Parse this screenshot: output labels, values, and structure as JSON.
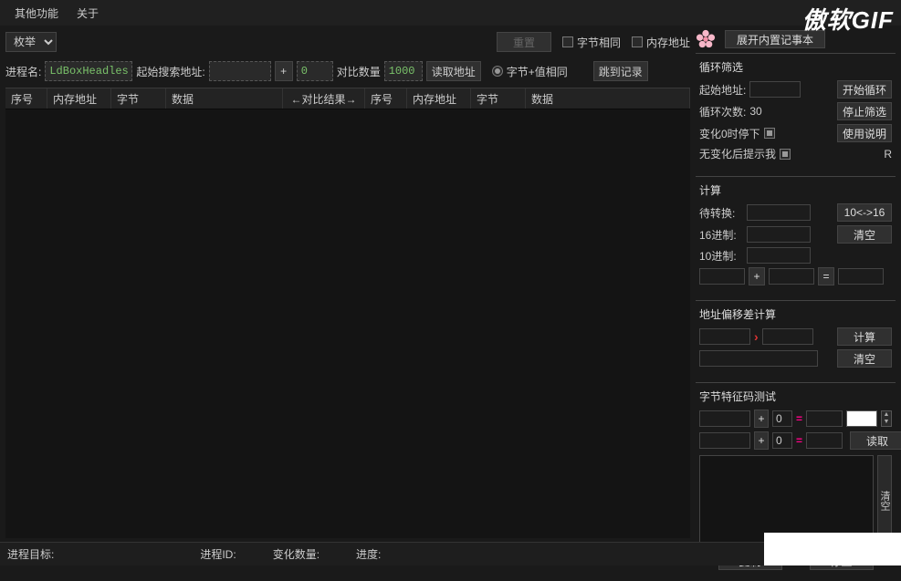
{
  "menu": {
    "other": "其他功能",
    "about": "关于"
  },
  "watermark": {
    "a": "傲软",
    "b": "GIF"
  },
  "toolbar1": {
    "enum_option": "枚举",
    "reset": "重置",
    "chk_byte_same": "字节相同",
    "chk_mem_addr": "内存地址",
    "expand_notepad": "展开内置记事本"
  },
  "toolbar2": {
    "proc_label": "进程名:",
    "proc_value": "LdBoxHeadless",
    "start_search_label": "起始搜索地址:",
    "start_search_value": "",
    "plus": "+",
    "offset_value": "0",
    "compare_count_label": "对比数量",
    "compare_count_value": "1000",
    "read_addr": "读取地址",
    "radio_byte_val_same": "字节+值相同",
    "jump_record": "跳到记录"
  },
  "columns": {
    "idx": "序号",
    "memaddr": "内存地址",
    "byte": "字节",
    "data": "数据",
    "compare": "←对比结果→"
  },
  "loop": {
    "title": "循环筛选",
    "start_addr": "起始地址:",
    "loop_count": "循环次数:",
    "loop_count_val": "30",
    "stop_on_zero": "变化0时停下",
    "notify_no_change": "无变化后提示我",
    "start_loop": "开始循环",
    "stop_filter": "停止筛选",
    "usage": "使用说明",
    "r": "R"
  },
  "calc": {
    "title": "计算",
    "to_convert": "待转换:",
    "hex": "16进制:",
    "dec": "10进制:",
    "ten_sixteen": "10<->16",
    "clear": "清空",
    "plus": "+",
    "eq": "="
  },
  "offset": {
    "title": "地址偏移差计算",
    "calc": "计算",
    "clear": "清空"
  },
  "bytesig": {
    "title": "字节特征码测试",
    "plus": "+",
    "zero": "0",
    "eq": "=",
    "read": "读取",
    "copy": "复制",
    "stop": "停止",
    "clear_v": "清空"
  },
  "status": {
    "target": "进程目标:",
    "pid": "进程ID:",
    "change_count": "变化数量:",
    "progress": "进度:"
  }
}
